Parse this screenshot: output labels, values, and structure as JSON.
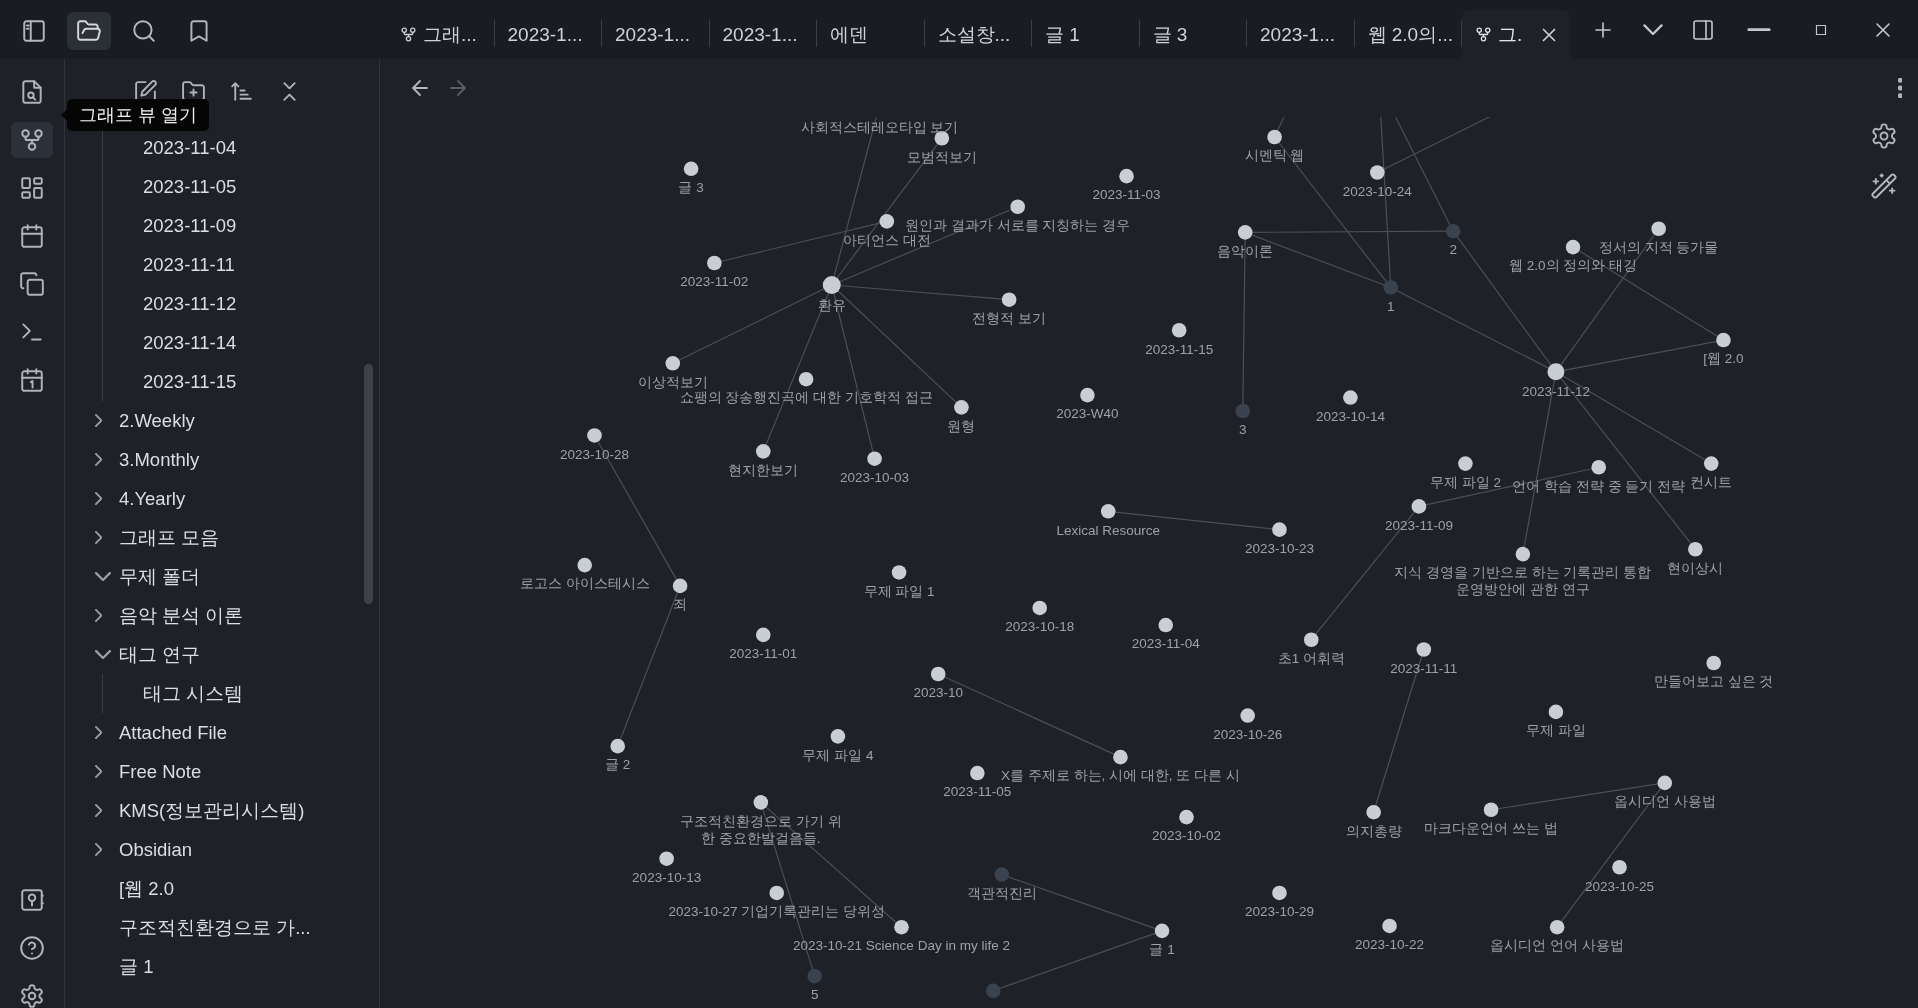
{
  "top_bar": {
    "buttons": [
      {
        "kind": "sidebar-toggle",
        "selected": false
      },
      {
        "kind": "files",
        "selected": true
      },
      {
        "kind": "search",
        "selected": false
      },
      {
        "kind": "bookmarks",
        "selected": false
      }
    ]
  },
  "tabs": [
    {
      "label": "그래...",
      "kind": "graph",
      "selected": false
    },
    {
      "label": "2023-1...",
      "kind": "note",
      "selected": false
    },
    {
      "label": "2023-1...",
      "kind": "note",
      "selected": false
    },
    {
      "label": "2023-1...",
      "kind": "note",
      "selected": false
    },
    {
      "label": "에덴",
      "kind": "note",
      "selected": false
    },
    {
      "label": "소설창...",
      "kind": "note",
      "selected": false
    },
    {
      "label": "글 1",
      "kind": "note",
      "selected": false
    },
    {
      "label": "글 3",
      "kind": "note",
      "selected": false
    },
    {
      "label": "2023-1...",
      "kind": "note",
      "selected": false
    },
    {
      "label": "웹 2.0의...",
      "kind": "note",
      "selected": false
    },
    {
      "label": "그.",
      "kind": "graph",
      "selected": true
    }
  ],
  "ribbon": {
    "top": [
      {
        "kind": "file-search",
        "hovered": false
      },
      {
        "kind": "graph",
        "hovered": true
      },
      {
        "kind": "canvas",
        "hovered": false
      },
      {
        "kind": "calendar",
        "hovered": false
      },
      {
        "kind": "copy",
        "hovered": false
      },
      {
        "kind": "terminal",
        "hovered": false
      },
      {
        "kind": "daily-note",
        "hovered": false
      }
    ],
    "bottom": [
      {
        "kind": "vault"
      },
      {
        "kind": "help"
      },
      {
        "kind": "settings"
      }
    ],
    "tooltip": "그래프 뷰 열기"
  },
  "explorer": {
    "tree": [
      {
        "kind": "group",
        "children": [
          {
            "label": "2023-11-04",
            "kind": "file"
          },
          {
            "label": "2023-11-05",
            "kind": "file"
          },
          {
            "label": "2023-11-09",
            "kind": "file"
          },
          {
            "label": "2023-11-11",
            "kind": "file"
          },
          {
            "label": "2023-11-12",
            "kind": "file"
          },
          {
            "label": "2023-11-14",
            "kind": "file"
          },
          {
            "label": "2023-11-15",
            "kind": "file"
          }
        ]
      },
      {
        "label": "2.Weekly",
        "kind": "folder",
        "expanded": false
      },
      {
        "label": "3.Monthly",
        "kind": "folder",
        "expanded": false
      },
      {
        "label": "4.Yearly",
        "kind": "folder",
        "expanded": false
      },
      {
        "label": "그래프 모음",
        "kind": "folder",
        "expanded": false
      },
      {
        "label": "무제 폴더",
        "kind": "folder",
        "expanded": true
      },
      {
        "label": "음악 분석 이론",
        "kind": "folder",
        "expanded": false
      },
      {
        "label": "태그 연구",
        "kind": "folder",
        "expanded": true,
        "children": [
          {
            "label": "태그 시스템",
            "kind": "file"
          }
        ]
      },
      {
        "label": "Attached File",
        "kind": "folder",
        "expanded": false
      },
      {
        "label": "Free Note",
        "kind": "folder",
        "expanded": false
      },
      {
        "label": "KMS(정보관리시스템)",
        "kind": "folder",
        "expanded": false
      },
      {
        "label": "Obsidian",
        "kind": "folder",
        "expanded": false
      },
      {
        "label": "[웹 2.0",
        "kind": "file"
      },
      {
        "label": "구조적친환경으로 가...",
        "kind": "file"
      },
      {
        "label": "글 1",
        "kind": "file"
      }
    ]
  },
  "graph": {
    "nav": {
      "back_enabled": true,
      "forward_enabled": false
    },
    "nodes": [
      {
        "label": "사회적스테레오타입 보기",
        "kind": "cut"
      },
      {
        "label": "모범적보기",
        "kind": "note"
      },
      {
        "label": "글 3",
        "kind": "note"
      },
      {
        "label": "2023-11-03",
        "kind": "note"
      },
      {
        "label": "원인과 결과가 서로를 지칭하는 경우",
        "kind": "note"
      },
      {
        "label": "아티언스 대전",
        "kind": "note"
      },
      {
        "label": "2023-11-02",
        "kind": "note"
      },
      {
        "label": "환유",
        "kind": "note"
      },
      {
        "label": "전형적 보기",
        "kind": "note"
      },
      {
        "label": "2023-11-15",
        "kind": "note"
      },
      {
        "label": "이상적보기",
        "kind": "note"
      },
      {
        "label": "쇼팽의 장송행진곡에 대한 기호학적 접근",
        "kind": "note"
      },
      {
        "label": "원형",
        "kind": "note"
      },
      {
        "label": "2023-W40",
        "kind": "note"
      },
      {
        "label": "2023-10-28",
        "kind": "note"
      },
      {
        "label": "현지한보기",
        "kind": "note"
      },
      {
        "label": "2023-10-03",
        "kind": "note"
      },
      {
        "label": "Lexical Resource",
        "kind": "note"
      },
      {
        "label": "로고스 아이스테시스",
        "kind": "note"
      },
      {
        "label": "죄",
        "kind": "note"
      },
      {
        "label": "무제 파일 1",
        "kind": "note"
      },
      {
        "label": "2023-10-18",
        "kind": "note"
      },
      {
        "label": "2023-11-04",
        "kind": "note"
      },
      {
        "label": "2023-11-01",
        "kind": "note"
      },
      {
        "label": "2023-10",
        "kind": "note"
      },
      {
        "label": "글 2",
        "kind": "note"
      },
      {
        "label": "무제 파일 4",
        "kind": "note"
      },
      {
        "label": "X를 주제로 하는, 시에 대한, 또 다른 시",
        "kind": "note"
      },
      {
        "label": "2023-11-05",
        "kind": "note"
      },
      {
        "label": "구조적친환경으로 가기 위한 중요한발걸음들.",
        "kind": "note"
      },
      {
        "label": "2023-10-13",
        "kind": "note"
      },
      {
        "label": "2023-10-27 기업기록관리는 당위성",
        "kind": "note"
      },
      {
        "label": "객관적진리",
        "kind": "unresolved"
      },
      {
        "label": "2023-10-21 Science Day in my life 2",
        "kind": "note"
      },
      {
        "label": "글 1",
        "kind": "note"
      },
      {
        "label": "5",
        "kind": "unresolved"
      },
      {
        "kind": "unresolved"
      },
      {
        "label": "시멘틱 웹",
        "kind": "note"
      },
      {
        "label": "2023-10-24",
        "kind": "note"
      },
      {
        "label": "음악이론",
        "kind": "note"
      },
      {
        "label": "2",
        "kind": "unresolved"
      },
      {
        "label": "1",
        "kind": "unresolved"
      },
      {
        "label": "정서의 지적 등가물",
        "kind": "note"
      },
      {
        "label": "웹 2.0의 정의와 태깅",
        "kind": "note"
      },
      {
        "label": "[웹 2.0",
        "kind": "note"
      },
      {
        "label": "2023-11-12",
        "kind": "note"
      },
      {
        "label": "3",
        "kind": "unresolved"
      },
      {
        "label": "2023-10-14",
        "kind": "note"
      },
      {
        "label": "무제 파일 2",
        "kind": "note"
      },
      {
        "label": "언어 학습 전략 중 듣기 전략",
        "kind": "note"
      },
      {
        "label": "컨시트",
        "kind": "note"
      },
      {
        "label": "2023-11-09",
        "kind": "note"
      },
      {
        "label": "2023-10-23",
        "kind": "note"
      },
      {
        "label": "지식 경영을 기반으로 하는 기록관리 통합 운영방안에 관한 연구",
        "kind": "note"
      },
      {
        "label": "현이상시",
        "kind": "note"
      },
      {
        "label": "초1 어휘력",
        "kind": "note"
      },
      {
        "label": "2023-11-11",
        "kind": "note"
      },
      {
        "label": "만들어보고 싶은 것",
        "kind": "note"
      },
      {
        "label": "2023-10-26",
        "kind": "note"
      },
      {
        "label": "무제 파일",
        "kind": "note"
      },
      {
        "label": "옵시디언 사용법",
        "kind": "note"
      },
      {
        "label": "의지총량",
        "kind": "note"
      },
      {
        "label": "마크다운언어 쓰는 법",
        "kind": "note"
      },
      {
        "label": "2023-10-02",
        "kind": "note"
      },
      {
        "label": "2023-10-25",
        "kind": "note"
      },
      {
        "label": "2023-10-29",
        "kind": "note"
      },
      {
        "label": "2023-10-22",
        "kind": "note"
      },
      {
        "label": "옵시디언 언어 사용법",
        "kind": "note"
      }
    ]
  }
}
